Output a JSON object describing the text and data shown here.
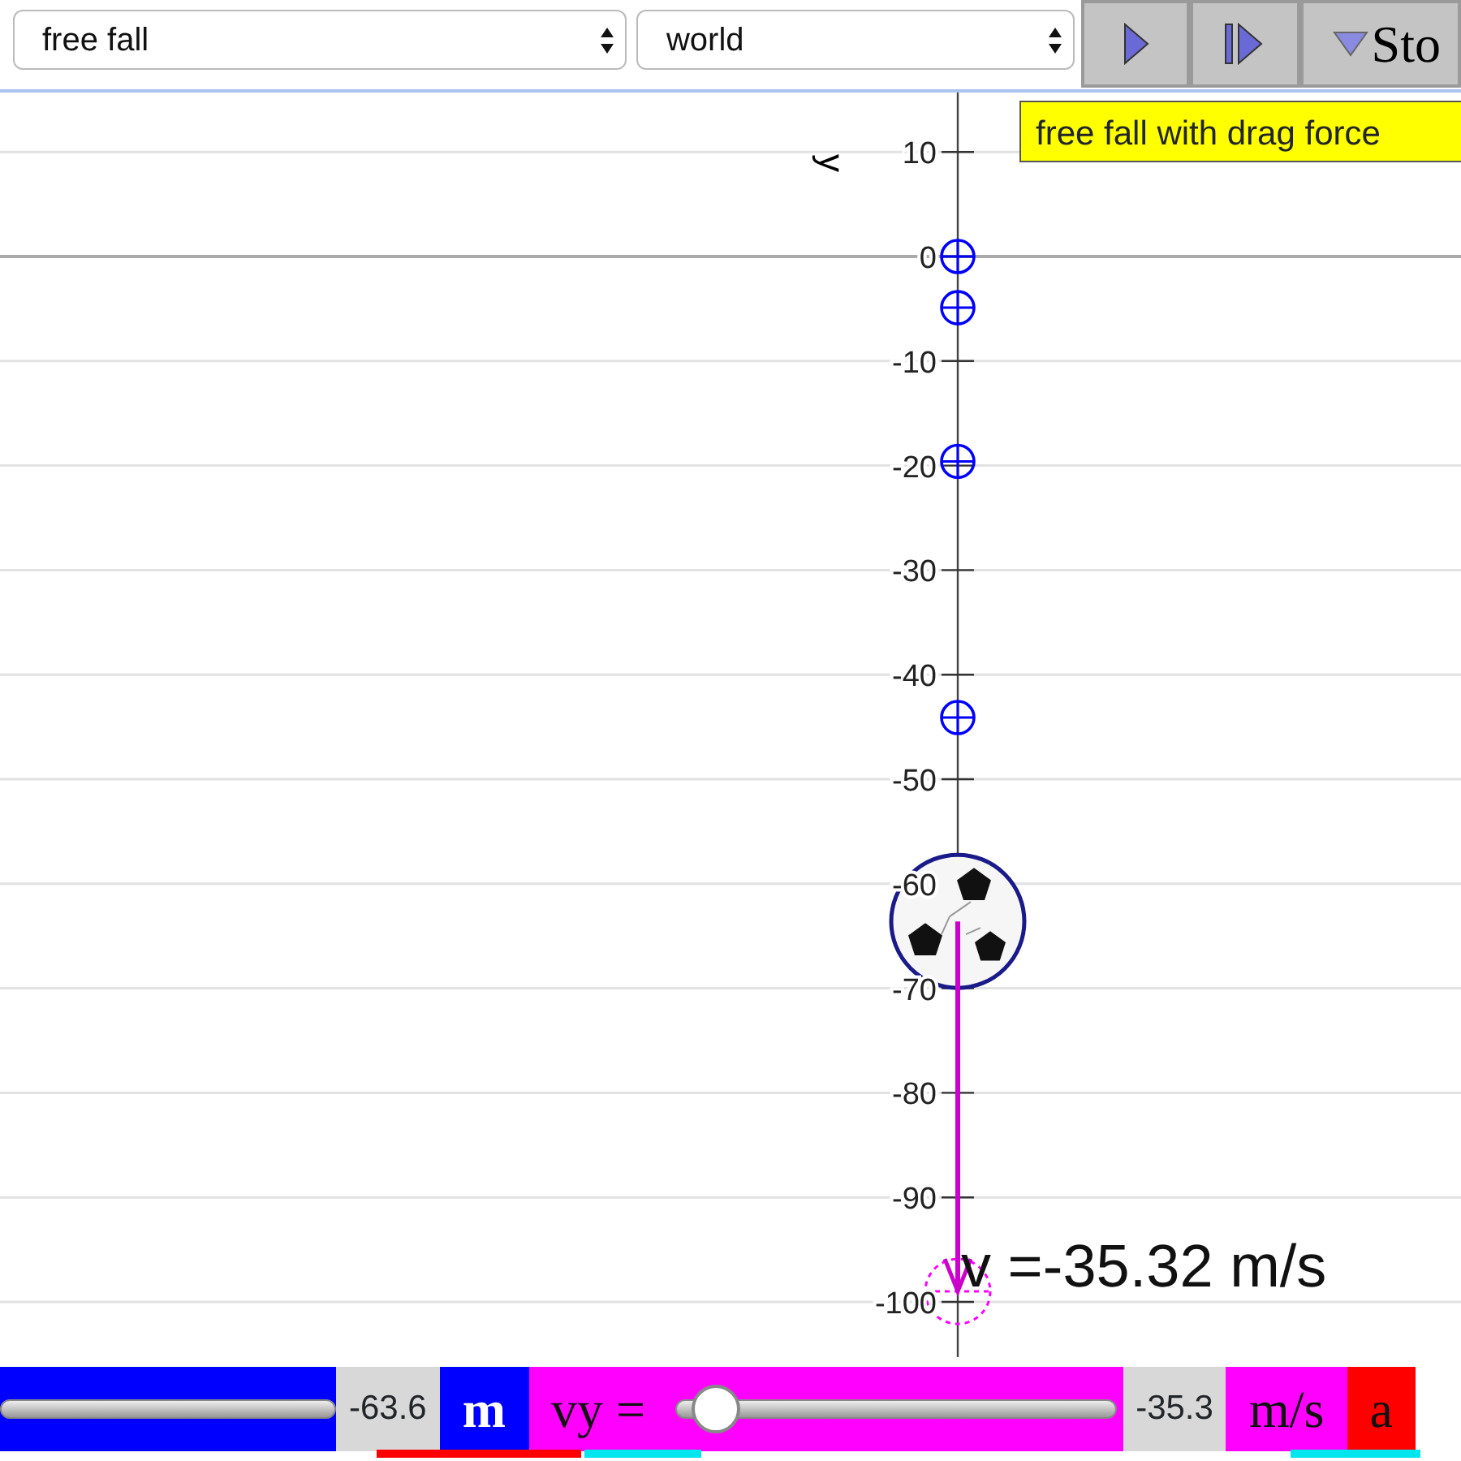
{
  "toolbar": {
    "dropdowns": [
      {
        "value": "free fall"
      },
      {
        "value": "world"
      }
    ],
    "buttons": [
      {
        "kind": "play"
      },
      {
        "kind": "step"
      },
      {
        "kind": "menu",
        "label": "Sto"
      }
    ]
  },
  "tooltip": {
    "text": "free fall with drag force"
  },
  "scene": {
    "axis_label": "y",
    "ticks": [
      "10",
      "0",
      "-10",
      "-20",
      "-30",
      "-40",
      "-50",
      "-60",
      "-70",
      "-80",
      "-90",
      "-100"
    ],
    "velocity_label": "v =-35.32 m/s"
  },
  "controls": [
    {
      "kind": "slider",
      "color": "#0000ff"
    },
    {
      "kind": "number",
      "text": "-63.6"
    },
    {
      "kind": "unit",
      "text": "m",
      "color": "#0000ff"
    },
    {
      "kind": "label",
      "text": "vy =",
      "color": "#ff00ff"
    },
    {
      "kind": "slider",
      "color": "#ff00ff",
      "level": 0.04
    },
    {
      "kind": "number",
      "text": "-35.3"
    },
    {
      "kind": "unit",
      "text": "m/s",
      "color": "#ff00ff"
    },
    {
      "kind": "unit",
      "text": "a",
      "color": "#ff0000"
    }
  ]
}
